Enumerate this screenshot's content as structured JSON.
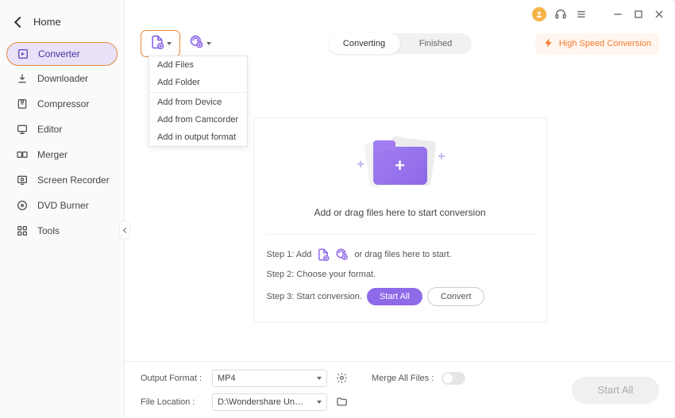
{
  "home_label": "Home",
  "sidebar_items": [
    {
      "label": "Converter",
      "active": true
    },
    {
      "label": "Downloader",
      "active": false
    },
    {
      "label": "Compressor",
      "active": false
    },
    {
      "label": "Editor",
      "active": false
    },
    {
      "label": "Merger",
      "active": false
    },
    {
      "label": "Screen Recorder",
      "active": false
    },
    {
      "label": "DVD Burner",
      "active": false
    },
    {
      "label": "Tools",
      "active": false
    }
  ],
  "tabs": {
    "converting": "Converting",
    "finished": "Finished"
  },
  "high_speed_label": "High Speed Conversion",
  "dropdown_items": [
    "Add Files",
    "Add Folder",
    "Add from Device",
    "Add from Camcorder",
    "Add in output format"
  ],
  "drop_text": "Add or drag files here to start conversion",
  "step1_pre": "Step 1: Add",
  "step1_post": "or drag files here to start.",
  "step2": "Step 2: Choose your format.",
  "step3": "Step 3: Start conversion.",
  "start_all": "Start All",
  "convert": "Convert",
  "footer": {
    "output_format_label": "Output Format :",
    "output_format_value": "MP4",
    "merge_label": "Merge All Files :",
    "file_location_label": "File Location :",
    "file_location_value": "D:\\Wondershare UniConverter 1",
    "start_all": "Start All"
  },
  "colors": {
    "accent": "#8e69e8",
    "orange": "#e7893c",
    "hs": "#f5782e"
  }
}
